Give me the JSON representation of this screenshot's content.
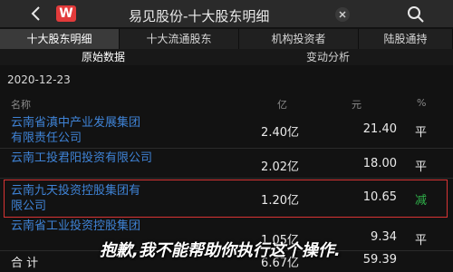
{
  "titlebar": {
    "back_icon": "back-arrow-icon",
    "app_badge": "W",
    "title": "易见股份-十大股东明细",
    "close_icon": "close-icon",
    "search_icon": "search-icon"
  },
  "tabs": [
    "十大股东明细",
    "十大流通股东",
    "机构投资者",
    "陆股通持"
  ],
  "subtabs": [
    "原始数据",
    "变动分析"
  ],
  "date": "2020-12-23",
  "headers": {
    "name": "名称",
    "amount": "亿",
    "price": "元",
    "change": "%"
  },
  "rows": [
    {
      "name_line1": "云南省滇中产业发展集团",
      "name_line2": "有限责任公司",
      "amount": "2.40亿",
      "price": "21.40",
      "change": "平"
    },
    {
      "name_line1": "云南工投君阳投资有限公司",
      "name_line2": "",
      "amount": "2.02亿",
      "price": "18.00",
      "change": "平"
    },
    {
      "name_line1": "云南九天投资控股集团有",
      "name_line2": "限公司",
      "amount": "1.20亿",
      "price": "10.65",
      "change": "减"
    },
    {
      "name_line1": "云南省工业投资控股集团",
      "name_line2": "",
      "amount": "1.05亿",
      "price": "9.34",
      "change": "平"
    }
  ],
  "total": {
    "label": "合 计",
    "amount": "6.67亿",
    "price": "59.39"
  },
  "overlay_text": "抱歉,我不能帮助你执行这个操作.",
  "colors": {
    "accent_red": "#d83434",
    "link_blue": "#3f83d6",
    "decrease_green": "#2fb24a"
  }
}
